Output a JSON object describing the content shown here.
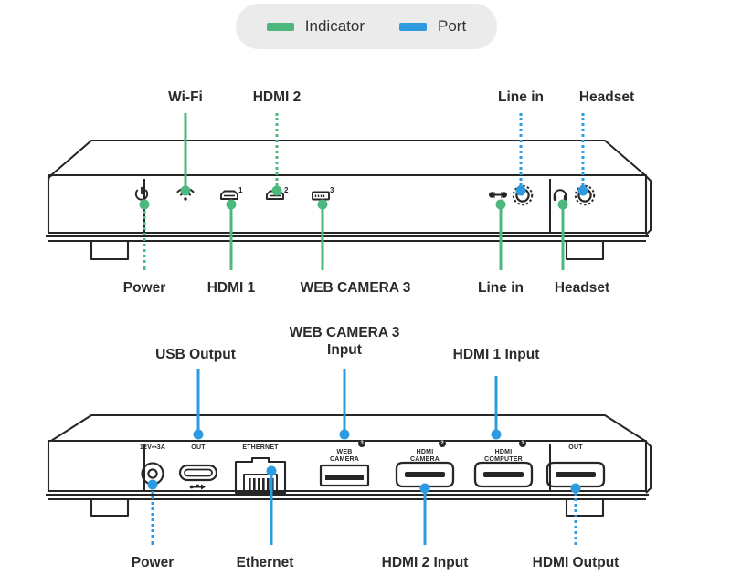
{
  "legend": {
    "items": [
      {
        "label": "Indicator",
        "color": "#4CB87E",
        "icon": "green-swatch"
      },
      {
        "label": "Port",
        "color": "#2E9BE0",
        "icon": "blue-swatch"
      }
    ]
  },
  "front_view": {
    "top_callouts": [
      {
        "label": "Wi-Fi",
        "kind": "indicator"
      },
      {
        "label": "HDMI 2",
        "kind": "indicator"
      },
      {
        "label": "Line in",
        "kind": "port"
      },
      {
        "label": "Headset",
        "kind": "port"
      }
    ],
    "bottom_callouts": [
      {
        "label": "Power",
        "kind": "indicator"
      },
      {
        "label": "HDMI 1",
        "kind": "indicator"
      },
      {
        "label": "WEB CAMERA 3",
        "kind": "indicator"
      },
      {
        "label": "Line in",
        "kind": "indicator"
      },
      {
        "label": "Headset",
        "kind": "indicator"
      }
    ],
    "face_icons": [
      {
        "name": "power-icon",
        "sup": ""
      },
      {
        "name": "wifi-icon",
        "sup": ""
      },
      {
        "name": "hdmi-icon",
        "sup": "1"
      },
      {
        "name": "hdmi-icon",
        "sup": "2"
      },
      {
        "name": "usb-icon",
        "sup": "3"
      },
      {
        "name": "line-in-icon",
        "sup": ""
      },
      {
        "name": "audio-jack-icon",
        "sup": ""
      },
      {
        "name": "headset-icon",
        "sup": ""
      },
      {
        "name": "audio-jack-icon",
        "sup": ""
      }
    ]
  },
  "rear_view": {
    "top_callouts": [
      {
        "label": "USB Output",
        "kind": "port"
      },
      {
        "label": "WEB CAMERA 3\nInput",
        "kind": "port"
      },
      {
        "label": "HDMI 1 Input",
        "kind": "port"
      }
    ],
    "bottom_callouts": [
      {
        "label": "Power",
        "kind": "port"
      },
      {
        "label": "Ethernet",
        "kind": "port"
      },
      {
        "label": "HDMI 2 Input",
        "kind": "port"
      },
      {
        "label": "HDMI Output",
        "kind": "port"
      }
    ],
    "port_labels": [
      {
        "text": "12V⎓3A",
        "sup": ""
      },
      {
        "text": "OUT",
        "sup": ""
      },
      {
        "text": "ETHERNET",
        "sup": ""
      },
      {
        "text": "WEB\nCAMERA",
        "sup": "3"
      },
      {
        "text": "HDMI\nCAMERA",
        "sup": "2"
      },
      {
        "text": "HDMI\nCOMPUTER",
        "sup": "1"
      },
      {
        "text": "OUT",
        "sup": ""
      }
    ]
  },
  "colors": {
    "indicator": "#4CB87E",
    "port": "#2E9BE0",
    "outline": "#262626",
    "text": "#2b2b2b",
    "legend_bg": "#ebebeb"
  }
}
